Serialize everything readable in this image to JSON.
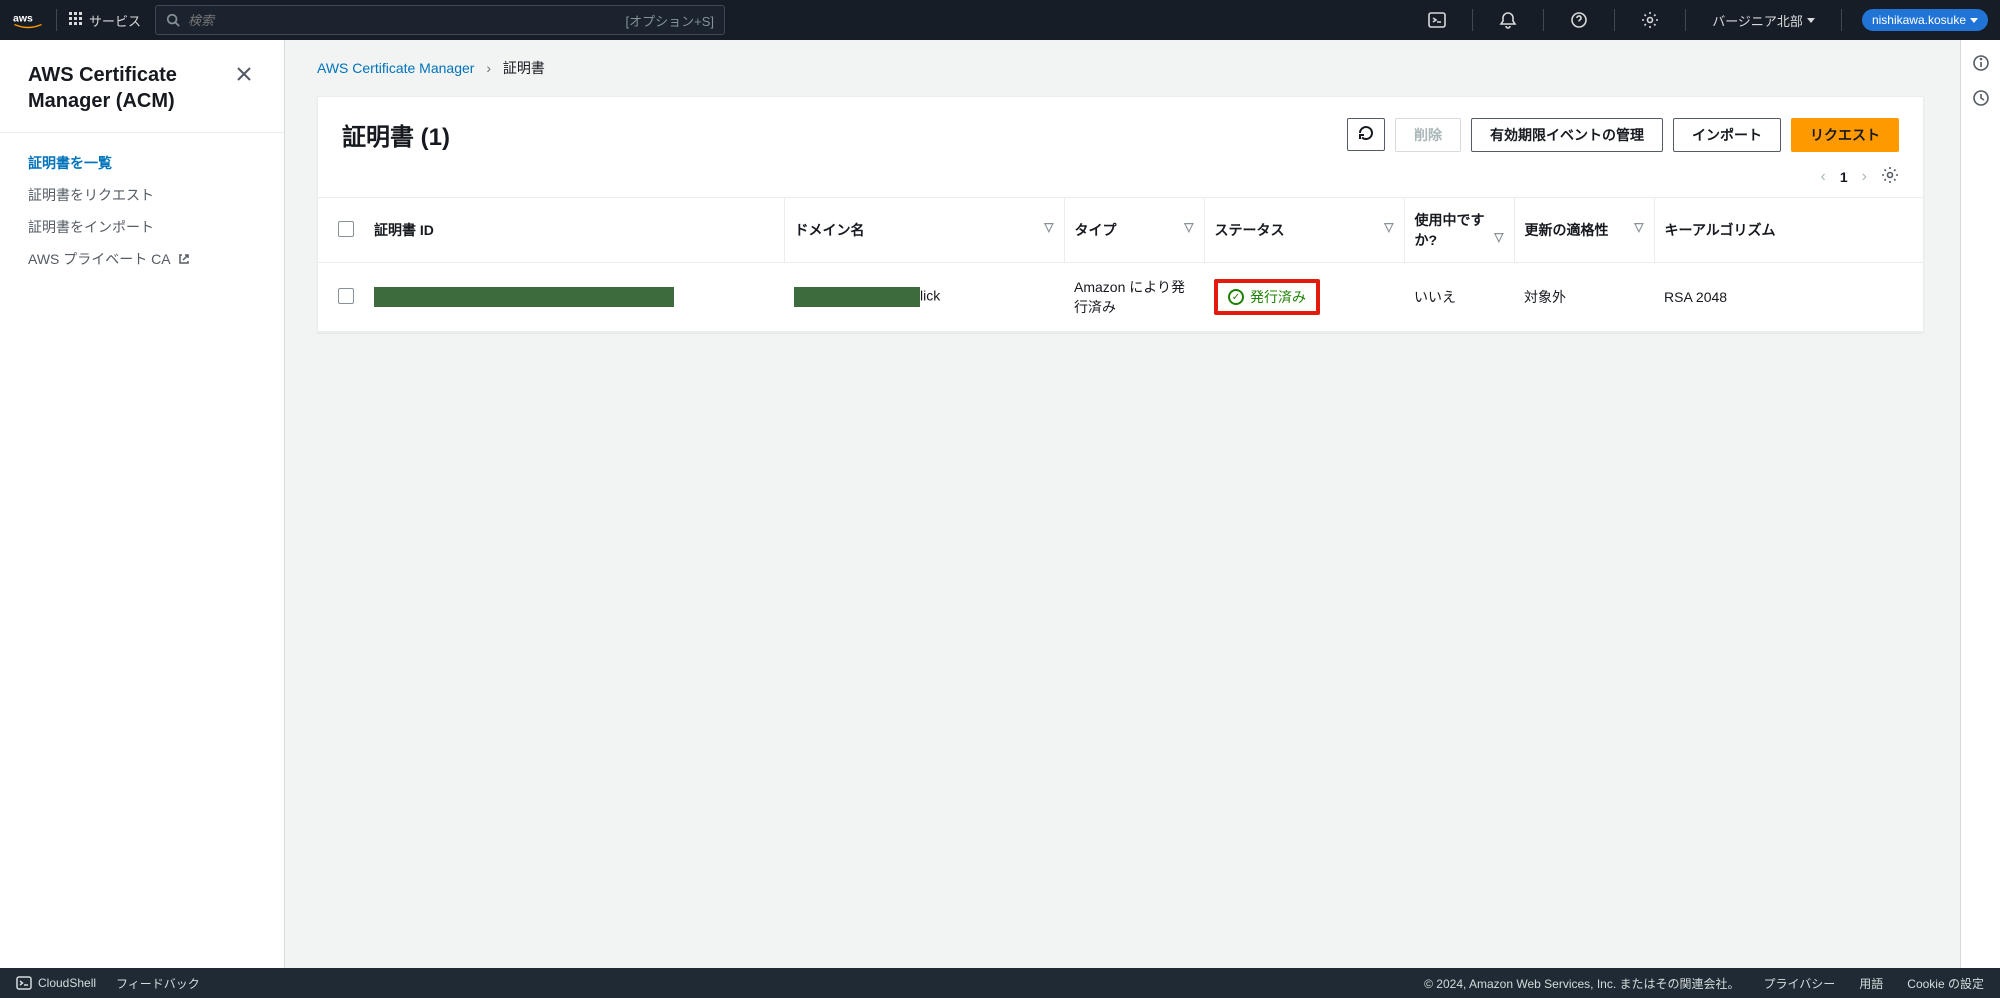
{
  "topnav": {
    "services": "サービス",
    "search_placeholder": "検索",
    "search_hint": "[オプション+S]",
    "region": "バージニア北部",
    "account": "nishikawa.kosuke"
  },
  "sidebar": {
    "title": "AWS Certificate Manager (ACM)",
    "items": [
      {
        "label": "証明書を一覧",
        "active": true
      },
      {
        "label": "証明書をリクエスト"
      },
      {
        "label": "証明書をインポート"
      },
      {
        "label": "AWS プライベート CA",
        "external": true
      }
    ]
  },
  "breadcrumb": {
    "root": "AWS Certificate Manager",
    "current": "証明書"
  },
  "panel": {
    "title": "証明書 (1)",
    "refresh": "↻",
    "delete": "削除",
    "manage_expiry": "有効期限イベントの管理",
    "import": "インポート",
    "request": "リクエスト",
    "page": "1"
  },
  "columns": {
    "id": "証明書 ID",
    "domain": "ドメイン名",
    "type": "タイプ",
    "status": "ステータス",
    "in_use": "使用中ですか?",
    "renewal": "更新の適格性",
    "algo": "キーアルゴリズム"
  },
  "rows": [
    {
      "domain_suffix": "lick",
      "type": "Amazon により発行済み",
      "status": "発行済み",
      "in_use": "いいえ",
      "renewal": "対象外",
      "algo": "RSA 2048"
    }
  ],
  "footer": {
    "cloudshell": "CloudShell",
    "feedback": "フィードバック",
    "copyright": "© 2024, Amazon Web Services, Inc. またはその関連会社。",
    "privacy": "プライバシー",
    "terms": "用語",
    "cookie": "Cookie の設定"
  }
}
